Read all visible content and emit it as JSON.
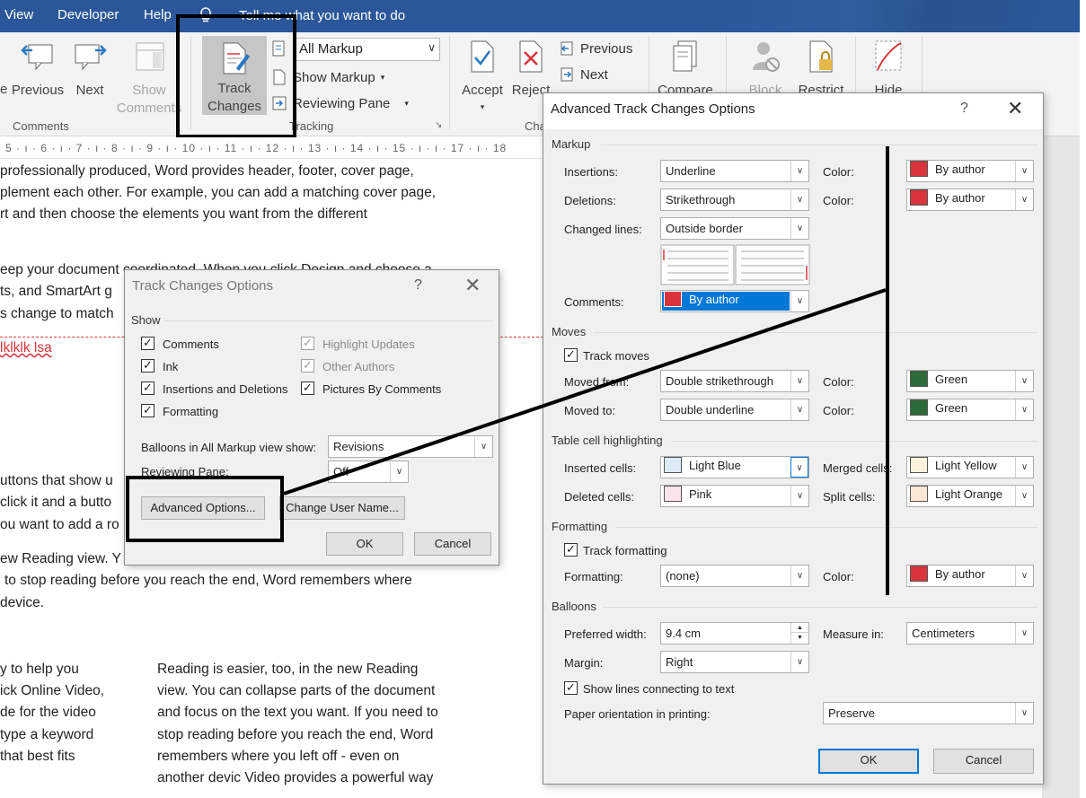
{
  "menubar": {
    "tabs": [
      "View",
      "Developer",
      "Help"
    ],
    "tell_me": "Tell me what you want to do"
  },
  "ribbon": {
    "comments_group": {
      "label": "Comments",
      "previous": "Previous",
      "next": "Next",
      "show_comments": "Show Comments"
    },
    "tracking_group": {
      "label": "Tracking",
      "track_changes": "Track Changes",
      "markup_combo": "All Markup",
      "show_markup": "Show Markup",
      "reviewing_pane": "Reviewing Pane"
    },
    "changes_group": {
      "label": "Cha",
      "accept": "Accept",
      "reject": "Reject",
      "previous": "Previous",
      "next": "Next"
    },
    "compare": "Compare",
    "block": "Block",
    "restrict": "Restrict",
    "hide": "Hide",
    "prev_partial": "e"
  },
  "ruler": "5 · ı · 6 · ı · 7 · ı · 8 · ı · 9 · ı · 10 · ı · 11 · ı · 12 · ı · 13 · ı · 14 · ı · 15 · ı     · ı · 17 · ı · 18",
  "document": {
    "lines": [
      "professionally produced, Word provides header, footer, cover page,",
      "plement each other. For example, you can add a matching cover page,",
      "rt and then choose the elements you want from the different",
      "eep your document coordinated. When you click Design and choose a",
      "ts, and SmartArt g",
      "s change to match",
      "lklklk lsa",
      "uttons that show u",
      "click it and a butto",
      "ou want to add a ro",
      "ew Reading view. Y",
      "to stop reading before you reach the end, Word remembers where",
      "device.",
      "y to help you",
      "ick Online Video,",
      "de for the video",
      "type a keyword",
      "that best fits"
    ],
    "column2": [
      "Reading is easier, too, in the new Reading",
      "view. You can collapse parts of the document",
      "and focus on the text you want. If you need to",
      "stop reading before you reach the end, Word",
      "remembers where you left off - even on",
      "another devic Video provides a powerful way"
    ]
  },
  "track_changes_dialog": {
    "title": "Track Changes Options",
    "help": "?",
    "show_label": "Show",
    "checks": [
      {
        "label": "Comments",
        "checked": true,
        "enabled": true
      },
      {
        "label": "Ink",
        "checked": true,
        "enabled": true
      },
      {
        "label": "Insertions and Deletions",
        "checked": true,
        "enabled": true
      },
      {
        "label": "Formatting",
        "checked": true,
        "enabled": true
      },
      {
        "label": "Highlight Updates",
        "checked": true,
        "enabled": false
      },
      {
        "label": "Other Authors",
        "checked": true,
        "enabled": false
      },
      {
        "label": "Pictures By Comments",
        "checked": true,
        "enabled": true
      }
    ],
    "balloons_label": "Balloons in All Markup view show:",
    "balloons_value": "Revisions",
    "reviewing_pane_label": "Reviewing Pane:",
    "reviewing_pane_value": "Off",
    "advanced_button": "Advanced Options...",
    "change_user_button": "Change User Name...",
    "ok": "OK",
    "cancel": "Cancel"
  },
  "advanced_dialog": {
    "title": "Advanced Track Changes Options",
    "help": "?",
    "markup": {
      "label": "Markup",
      "insertions_label": "Insertions:",
      "insertions_value": "Underline",
      "deletions_label": "Deletions:",
      "deletions_value": "Strikethrough",
      "changed_lines_label": "Changed lines:",
      "changed_lines_value": "Outside border",
      "comments_label": "Comments:",
      "comments_value": "By author",
      "color_label": "Color:",
      "insert_color": "By author",
      "delete_color": "By author"
    },
    "moves": {
      "label": "Moves",
      "track_moves": "Track moves",
      "moved_from_label": "Moved from:",
      "moved_from_value": "Double strikethrough",
      "moved_to_label": "Moved to:",
      "moved_to_value": "Double underline",
      "from_color": "Green",
      "to_color": "Green"
    },
    "table": {
      "label": "Table cell highlighting",
      "inserted_label": "Inserted cells:",
      "inserted_value": "Light Blue",
      "deleted_label": "Deleted cells:",
      "deleted_value": "Pink",
      "merged_label": "Merged cells:",
      "merged_value": "Light Yellow",
      "split_label": "Split cells:",
      "split_value": "Light Orange"
    },
    "formatting": {
      "label": "Formatting",
      "track_formatting": "Track formatting",
      "formatting_label": "Formatting:",
      "formatting_value": "(none)",
      "color": "By author"
    },
    "balloons": {
      "label": "Balloons",
      "preferred_width_label": "Preferred width:",
      "preferred_width_value": "9.4 cm",
      "measure_label": "Measure in:",
      "measure_value": "Centimeters",
      "margin_label": "Margin:",
      "margin_value": "Right",
      "show_lines": "Show lines connecting to text",
      "paper_label": "Paper orientation in printing:",
      "paper_value": "Preserve"
    },
    "ok": "OK",
    "cancel": "Cancel"
  },
  "colors": {
    "ribbon_blue": "#2b579a",
    "by_author_red": "#d9343b",
    "green": "#2e6b3a",
    "light_blue": "#dcebf7",
    "pink": "#fbe3ec",
    "light_yellow": "#fdf3dd",
    "light_orange": "#fbe7d6",
    "selection_blue": "#0078d7"
  },
  "icons": [
    "lightbulb-icon",
    "previous-comment-icon",
    "next-comment-icon",
    "show-comments-icon",
    "track-changes-icon",
    "accept-icon",
    "reject-icon",
    "compare-icon",
    "block-icon",
    "restrict-icon",
    "hide-icon"
  ]
}
